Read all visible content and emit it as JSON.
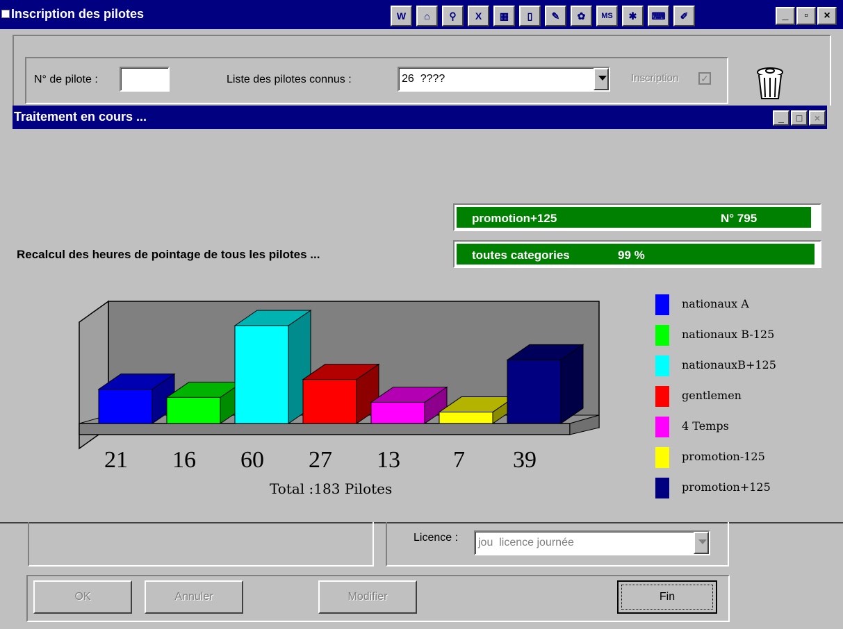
{
  "window": {
    "title": "Inscription des pilotes",
    "controls": [
      "_",
      "▫",
      "×"
    ]
  },
  "toolbar": {
    "icons": [
      "word-icon",
      "house-icon",
      "magnifier-icon",
      "excel-icon",
      "calculator-icon",
      "document-icon",
      "notepad-icon",
      "palette-icon",
      "msdos-icon",
      "gear-icon",
      "keyboard-icon",
      "paint-icon"
    ],
    "glyphs": [
      "W",
      "⌂",
      "⚲",
      "X",
      "▦",
      "▯",
      "✎",
      "✿",
      "MS",
      "✱",
      "⌨",
      "✐"
    ]
  },
  "top_form": {
    "pilot_number_label": "N° de pilote :",
    "pilot_number_value": "",
    "known_pilots_label": "Liste des pilotes connus :",
    "known_pilots_value": "26  ????",
    "inscription_label": "Inscription",
    "inscription_checked": true
  },
  "progress_dialog": {
    "title": "Traitement en cours ...",
    "controls": [
      "_",
      "□",
      "×"
    ],
    "message": "Recalcul des heures de pointage de tous les pilotes ...",
    "bar1": {
      "label": "promotion+125",
      "right_text": "N° 795",
      "percent": 98
    },
    "bar2": {
      "label": "toutes categories",
      "right_text": "99 %",
      "percent": 99
    }
  },
  "chart_data": {
    "type": "bar",
    "categories": [
      "nationaux A",
      "nationaux B-125",
      "nationauxB+125",
      "gentlemen",
      "4 Temps",
      "promotion-125",
      "promotion+125"
    ],
    "values": [
      21,
      16,
      60,
      27,
      13,
      7,
      39
    ],
    "colors": [
      "#0000ff",
      "#00ff00",
      "#00ffff",
      "#ff0000",
      "#ff00ff",
      "#ffff00",
      "#000080"
    ],
    "total_label": "Total :183 Pilotes",
    "legend_position": "right"
  },
  "bottom_form": {
    "licence_label": "Licence :",
    "licence_value": "jou  licence journée",
    "buttons": {
      "ok": "OK",
      "cancel": "Annuler",
      "modify": "Modifier",
      "end": "Fin"
    }
  }
}
